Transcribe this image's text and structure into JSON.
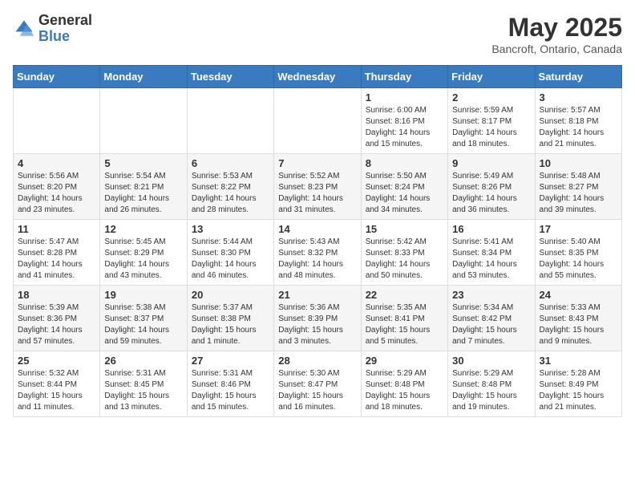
{
  "header": {
    "logo_general": "General",
    "logo_blue": "Blue",
    "month_title": "May 2025",
    "subtitle": "Bancroft, Ontario, Canada"
  },
  "days_of_week": [
    "Sunday",
    "Monday",
    "Tuesday",
    "Wednesday",
    "Thursday",
    "Friday",
    "Saturday"
  ],
  "weeks": [
    {
      "row_class": "row-odd",
      "days": [
        {
          "num": "",
          "info": ""
        },
        {
          "num": "",
          "info": ""
        },
        {
          "num": "",
          "info": ""
        },
        {
          "num": "",
          "info": ""
        },
        {
          "num": "1",
          "info": "Sunrise: 6:00 AM\nSunset: 8:16 PM\nDaylight: 14 hours\nand 15 minutes."
        },
        {
          "num": "2",
          "info": "Sunrise: 5:59 AM\nSunset: 8:17 PM\nDaylight: 14 hours\nand 18 minutes."
        },
        {
          "num": "3",
          "info": "Sunrise: 5:57 AM\nSunset: 8:18 PM\nDaylight: 14 hours\nand 21 minutes."
        }
      ]
    },
    {
      "row_class": "row-even",
      "days": [
        {
          "num": "4",
          "info": "Sunrise: 5:56 AM\nSunset: 8:20 PM\nDaylight: 14 hours\nand 23 minutes."
        },
        {
          "num": "5",
          "info": "Sunrise: 5:54 AM\nSunset: 8:21 PM\nDaylight: 14 hours\nand 26 minutes."
        },
        {
          "num": "6",
          "info": "Sunrise: 5:53 AM\nSunset: 8:22 PM\nDaylight: 14 hours\nand 28 minutes."
        },
        {
          "num": "7",
          "info": "Sunrise: 5:52 AM\nSunset: 8:23 PM\nDaylight: 14 hours\nand 31 minutes."
        },
        {
          "num": "8",
          "info": "Sunrise: 5:50 AM\nSunset: 8:24 PM\nDaylight: 14 hours\nand 34 minutes."
        },
        {
          "num": "9",
          "info": "Sunrise: 5:49 AM\nSunset: 8:26 PM\nDaylight: 14 hours\nand 36 minutes."
        },
        {
          "num": "10",
          "info": "Sunrise: 5:48 AM\nSunset: 8:27 PM\nDaylight: 14 hours\nand 39 minutes."
        }
      ]
    },
    {
      "row_class": "row-odd",
      "days": [
        {
          "num": "11",
          "info": "Sunrise: 5:47 AM\nSunset: 8:28 PM\nDaylight: 14 hours\nand 41 minutes."
        },
        {
          "num": "12",
          "info": "Sunrise: 5:45 AM\nSunset: 8:29 PM\nDaylight: 14 hours\nand 43 minutes."
        },
        {
          "num": "13",
          "info": "Sunrise: 5:44 AM\nSunset: 8:30 PM\nDaylight: 14 hours\nand 46 minutes."
        },
        {
          "num": "14",
          "info": "Sunrise: 5:43 AM\nSunset: 8:32 PM\nDaylight: 14 hours\nand 48 minutes."
        },
        {
          "num": "15",
          "info": "Sunrise: 5:42 AM\nSunset: 8:33 PM\nDaylight: 14 hours\nand 50 minutes."
        },
        {
          "num": "16",
          "info": "Sunrise: 5:41 AM\nSunset: 8:34 PM\nDaylight: 14 hours\nand 53 minutes."
        },
        {
          "num": "17",
          "info": "Sunrise: 5:40 AM\nSunset: 8:35 PM\nDaylight: 14 hours\nand 55 minutes."
        }
      ]
    },
    {
      "row_class": "row-even",
      "days": [
        {
          "num": "18",
          "info": "Sunrise: 5:39 AM\nSunset: 8:36 PM\nDaylight: 14 hours\nand 57 minutes."
        },
        {
          "num": "19",
          "info": "Sunrise: 5:38 AM\nSunset: 8:37 PM\nDaylight: 14 hours\nand 59 minutes."
        },
        {
          "num": "20",
          "info": "Sunrise: 5:37 AM\nSunset: 8:38 PM\nDaylight: 15 hours\nand 1 minute."
        },
        {
          "num": "21",
          "info": "Sunrise: 5:36 AM\nSunset: 8:39 PM\nDaylight: 15 hours\nand 3 minutes."
        },
        {
          "num": "22",
          "info": "Sunrise: 5:35 AM\nSunset: 8:41 PM\nDaylight: 15 hours\nand 5 minutes."
        },
        {
          "num": "23",
          "info": "Sunrise: 5:34 AM\nSunset: 8:42 PM\nDaylight: 15 hours\nand 7 minutes."
        },
        {
          "num": "24",
          "info": "Sunrise: 5:33 AM\nSunset: 8:43 PM\nDaylight: 15 hours\nand 9 minutes."
        }
      ]
    },
    {
      "row_class": "row-odd",
      "days": [
        {
          "num": "25",
          "info": "Sunrise: 5:32 AM\nSunset: 8:44 PM\nDaylight: 15 hours\nand 11 minutes."
        },
        {
          "num": "26",
          "info": "Sunrise: 5:31 AM\nSunset: 8:45 PM\nDaylight: 15 hours\nand 13 minutes."
        },
        {
          "num": "27",
          "info": "Sunrise: 5:31 AM\nSunset: 8:46 PM\nDaylight: 15 hours\nand 15 minutes."
        },
        {
          "num": "28",
          "info": "Sunrise: 5:30 AM\nSunset: 8:47 PM\nDaylight: 15 hours\nand 16 minutes."
        },
        {
          "num": "29",
          "info": "Sunrise: 5:29 AM\nSunset: 8:48 PM\nDaylight: 15 hours\nand 18 minutes."
        },
        {
          "num": "30",
          "info": "Sunrise: 5:29 AM\nSunset: 8:48 PM\nDaylight: 15 hours\nand 19 minutes."
        },
        {
          "num": "31",
          "info": "Sunrise: 5:28 AM\nSunset: 8:49 PM\nDaylight: 15 hours\nand 21 minutes."
        }
      ]
    }
  ]
}
